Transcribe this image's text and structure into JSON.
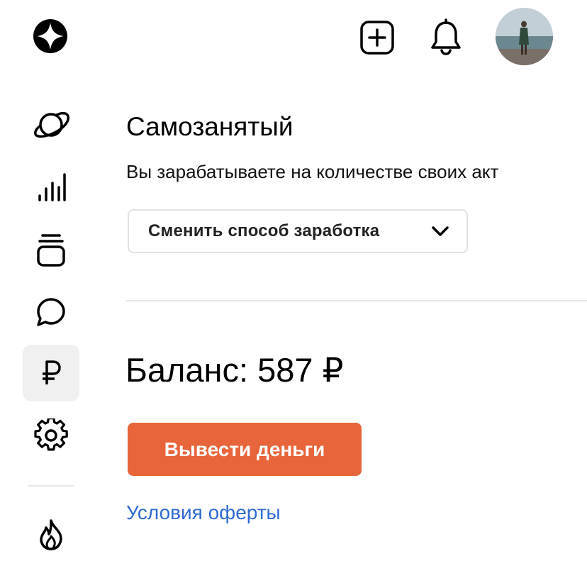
{
  "header": {
    "logo_icon": "sparkle-logo-icon",
    "actions": [
      {
        "name": "add",
        "icon": "plus-square-icon"
      },
      {
        "name": "notifications",
        "icon": "bell-icon"
      },
      {
        "name": "profile",
        "icon": "avatar"
      }
    ]
  },
  "sidebar": {
    "items": [
      {
        "icon": "planet-icon",
        "active": false
      },
      {
        "icon": "bar-chart-icon",
        "active": false
      },
      {
        "icon": "stack-icon",
        "active": false
      },
      {
        "icon": "chat-bubble-icon",
        "active": false
      },
      {
        "icon": "ruble-icon",
        "active": true
      },
      {
        "icon": "gear-icon",
        "active": false
      },
      {
        "icon": "fire-icon",
        "active": false
      }
    ]
  },
  "main": {
    "title": "Самозанятый",
    "subtitle": "Вы зарабатываете на количестве своих акт",
    "change_method_label": "Сменить способ заработка",
    "balance_text": "Баланс: 587 ₽",
    "withdraw_label": "Вывести деньги",
    "offer_link": "Условия оферты"
  },
  "colors": {
    "accent_button": "#e8643a",
    "link": "#2f6bd1",
    "active_sidebar_bg": "#f0f0f0",
    "divider": "#e6e6e6"
  }
}
